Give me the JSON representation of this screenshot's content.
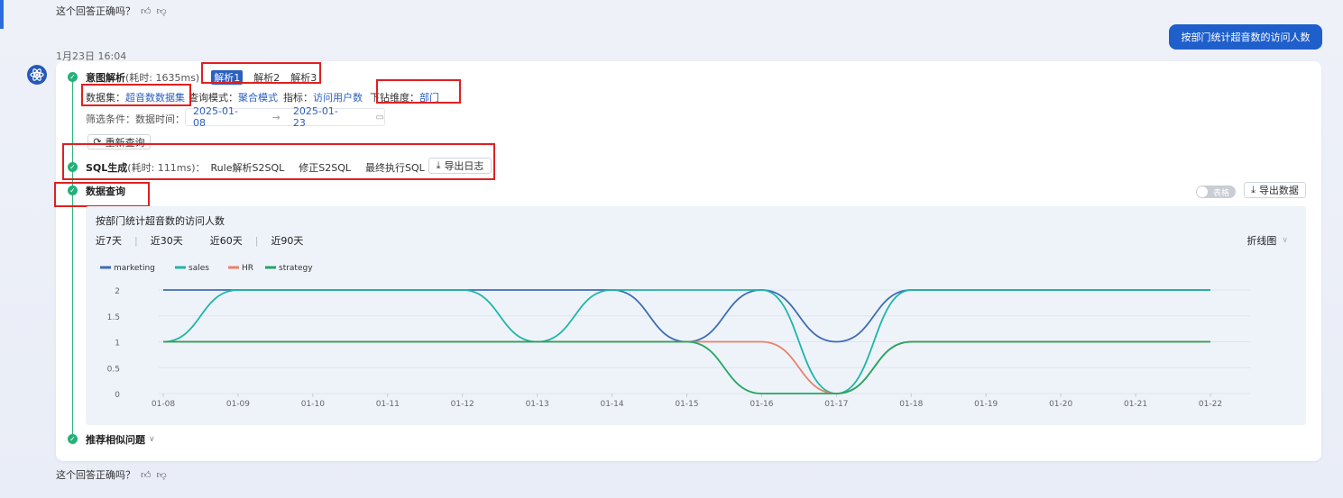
{
  "feedback": {
    "question": "这个回答正确吗？",
    "like_icon": "thumbs-up-icon",
    "dislike_icon": "thumbs-down-icon"
  },
  "timestamp": "1月23日 16:04",
  "user_message": "按部门统计超音数的访问人数",
  "intent": {
    "label": "意图解析",
    "time": "(耗时: 1635ms)：",
    "tabs": [
      "解析1",
      "解析2",
      "解析3"
    ],
    "active_tab": 0
  },
  "params": {
    "dataset_label": "数据集：",
    "dataset_value": "超音数数据集",
    "query_mode_label": "查询模式：",
    "query_mode_value": "聚合模式",
    "metric_label": "指标：",
    "metric_value": "访问用户数",
    "drill_label": "下钻维度：",
    "drill_value": "部门"
  },
  "filter": {
    "label": "筛选条件：数据时间：",
    "start": "2025-01-08",
    "arrow": "→",
    "end": "2025-01-23"
  },
  "requery_label": "重新查询",
  "sql": {
    "label": "SQL生成",
    "time": "(耗时: 111ms)：",
    "steps": [
      "Rule解析S2SQL",
      "修正S2SQL",
      "最终执行SQL"
    ],
    "export_log": "导出日志"
  },
  "data_query": {
    "label": "数据查询",
    "toggle_label": "表格",
    "export_data": "导出数据"
  },
  "chart_panel": {
    "title": "按部门统计超音数的访问人数",
    "ranges": [
      "近7天",
      "近30天",
      "近60天",
      "近90天"
    ],
    "chart_type_label": "折线图"
  },
  "chart_data": {
    "type": "line",
    "x": [
      "01-08",
      "01-09",
      "01-10",
      "01-11",
      "01-12",
      "01-13",
      "01-14",
      "01-15",
      "01-16",
      "01-17",
      "01-18",
      "01-19",
      "01-20",
      "01-21",
      "01-22"
    ],
    "ylim": [
      0,
      2
    ],
    "yticks": [
      "0",
      "0.5",
      "1",
      "1.5",
      "2"
    ],
    "legend_position": "top-left",
    "series": [
      {
        "name": "marketing",
        "color": "#3b6db5",
        "values": [
          2,
          2,
          2,
          2,
          2,
          2,
          2,
          1,
          2,
          1,
          2,
          2,
          2,
          2,
          2
        ]
      },
      {
        "name": "sales",
        "color": "#1fb5a8",
        "values": [
          1,
          2,
          2,
          2,
          2,
          1,
          2,
          2,
          2,
          0,
          2,
          2,
          2,
          2,
          2
        ]
      },
      {
        "name": "HR",
        "color": "#e8826a",
        "values": [
          1,
          1,
          1,
          1,
          1,
          1,
          1,
          1,
          1,
          0,
          1,
          1,
          1,
          1,
          1
        ]
      },
      {
        "name": "strategy",
        "color": "#23a660",
        "values": [
          1,
          1,
          1,
          1,
          1,
          1,
          1,
          1,
          0,
          0,
          1,
          1,
          1,
          1,
          1
        ]
      }
    ]
  },
  "recommend_label": "推荐相似问题"
}
